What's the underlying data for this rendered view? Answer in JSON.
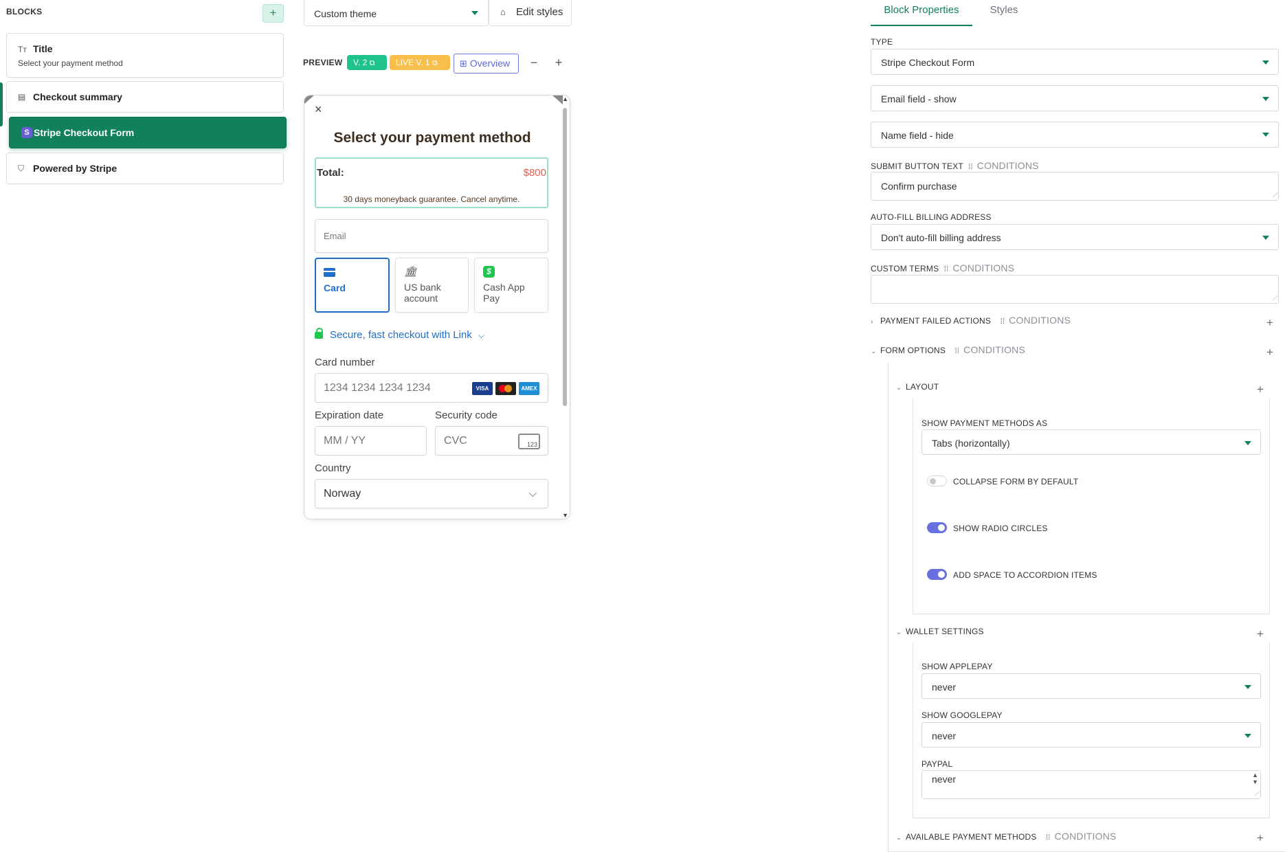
{
  "blocks": {
    "title": "BLOCKS",
    "add_label": "+",
    "items": [
      {
        "label": "Title",
        "sub": "Select your payment method",
        "icon": "Tт"
      },
      {
        "label": "Checkout summary",
        "icon": "▤"
      },
      {
        "label": "Stripe Checkout Form",
        "icon": "S"
      },
      {
        "label": "Powered by Stripe",
        "icon": "⛉"
      }
    ]
  },
  "toolbar": {
    "theme": "Custom theme",
    "edit_styles": "Edit styles",
    "preview": "PREVIEW",
    "v2": "V. 2",
    "live": "LIVE V. 1",
    "overview": "Overview",
    "zoom_out": "−",
    "zoom_in": "+"
  },
  "preview": {
    "close": "×",
    "title": "Select your payment method",
    "total_label": "Total:",
    "total_value": "$800",
    "guarantee": "30 days moneyback guarantee. Cancel anytime.",
    "email_placeholder": "Email",
    "methods": [
      {
        "label": "Card",
        "icon": "card-icon"
      },
      {
        "label": "US bank account",
        "icon": "bank-icon"
      },
      {
        "label": "Cash App Pay",
        "icon": "cashapp-icon"
      }
    ],
    "link_text": "Secure, fast checkout with Link",
    "card_number_label": "Card number",
    "card_number_placeholder": "1234 1234 1234 1234",
    "brands": [
      "VISA",
      "MC",
      "AMEX"
    ],
    "expiry_label": "Expiration date",
    "expiry_placeholder": "MM / YY",
    "cvc_label": "Security code",
    "cvc_placeholder": "CVC",
    "cvc_icon_text": "123",
    "country_label": "Country",
    "country_value": "Norway"
  },
  "panel": {
    "tabs": {
      "properties": "Block Properties",
      "styles": "Styles"
    },
    "type_label": "TYPE",
    "type_value": "Stripe Checkout Form",
    "email_field": "Email field - show",
    "name_field": "Name field - hide",
    "submit_label": "SUBMIT BUTTON TEXT",
    "conditions": "CONDITIONS",
    "submit_value": "Confirm purchase",
    "autofill_label": "AUTO-FILL BILLING ADDRESS",
    "autofill_value": "Don't auto-fill billing address",
    "custom_terms_label": "CUSTOM TERMS",
    "custom_terms_value": "",
    "payment_failed_label": "PAYMENT FAILED ACTIONS",
    "form_options_label": "FORM OPTIONS",
    "layout_label": "LAYOUT",
    "show_pm_as_label": "SHOW PAYMENT METHODS AS",
    "show_pm_as_value": "Tabs (horizontally)",
    "toggles": [
      {
        "label": "COLLAPSE FORM BY DEFAULT",
        "on": false
      },
      {
        "label": "SHOW RADIO CIRCLES",
        "on": true
      },
      {
        "label": "ADD SPACE TO ACCORDION ITEMS",
        "on": true
      }
    ],
    "wallet_label": "WALLET SETTINGS",
    "applepay_label": "SHOW APPLEPAY",
    "applepay_value": "never",
    "googlepay_label": "SHOW GOOGLEPAY",
    "googlepay_value": "never",
    "paypal_label": "PAYPAL",
    "paypal_value": "never",
    "available_pm_label": "AVAILABLE PAYMENT METHODS",
    "plus": "+"
  },
  "colors": {
    "brand_green": "#118159",
    "accent_blue": "#1f6fc8",
    "toggle_on": "#6870e0",
    "total_red": "#e35d4e"
  }
}
